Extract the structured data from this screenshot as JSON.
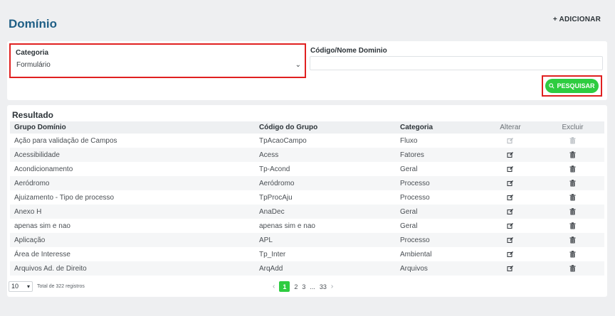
{
  "header": {
    "title": "Domínio",
    "add_label": "+ ADICIONAR"
  },
  "filters": {
    "category_label": "Categoria",
    "category_value": "Formulário",
    "code_label": "Código/Nome Dominio",
    "code_value": "",
    "search_label": "PESQUISAR"
  },
  "results": {
    "title": "Resultado",
    "columns": [
      "Grupo Domínio",
      "Código do Grupo",
      "Categoria",
      "Alterar",
      "Excluir"
    ],
    "rows": [
      [
        "Ação para validação de Campos",
        "TpAcaoCampo",
        "Fluxo"
      ],
      [
        "Acessibilidade",
        "Acess",
        "Fatores"
      ],
      [
        "Acondicionamento",
        "Tp-Acond",
        "Geral"
      ],
      [
        "Aeródromo",
        "Aeródromo",
        "Processo"
      ],
      [
        "Ajuizamento - Tipo de processo",
        "TpProcAju",
        "Processo"
      ],
      [
        "Anexo H",
        "AnaDec",
        "Geral"
      ],
      [
        "apenas sim e nao",
        "apenas sim e nao",
        "Geral"
      ],
      [
        "Aplicação",
        "APL",
        "Processo"
      ],
      [
        "Área de Interesse",
        "Tp_Inter",
        "Ambiental"
      ],
      [
        "Arquivos Ad. de Direito",
        "ArqAdd",
        "Arquivos"
      ]
    ]
  },
  "pagination": {
    "page_size": "10",
    "total_text": "Total de 322 registros",
    "prev": "‹",
    "current": "1",
    "page2": "2",
    "page3": "3",
    "ellipsis": "...",
    "last": "33",
    "next": "›"
  },
  "colors": {
    "accent": "#2ecc40",
    "title": "#1f5f86",
    "highlight": "#e02020"
  }
}
